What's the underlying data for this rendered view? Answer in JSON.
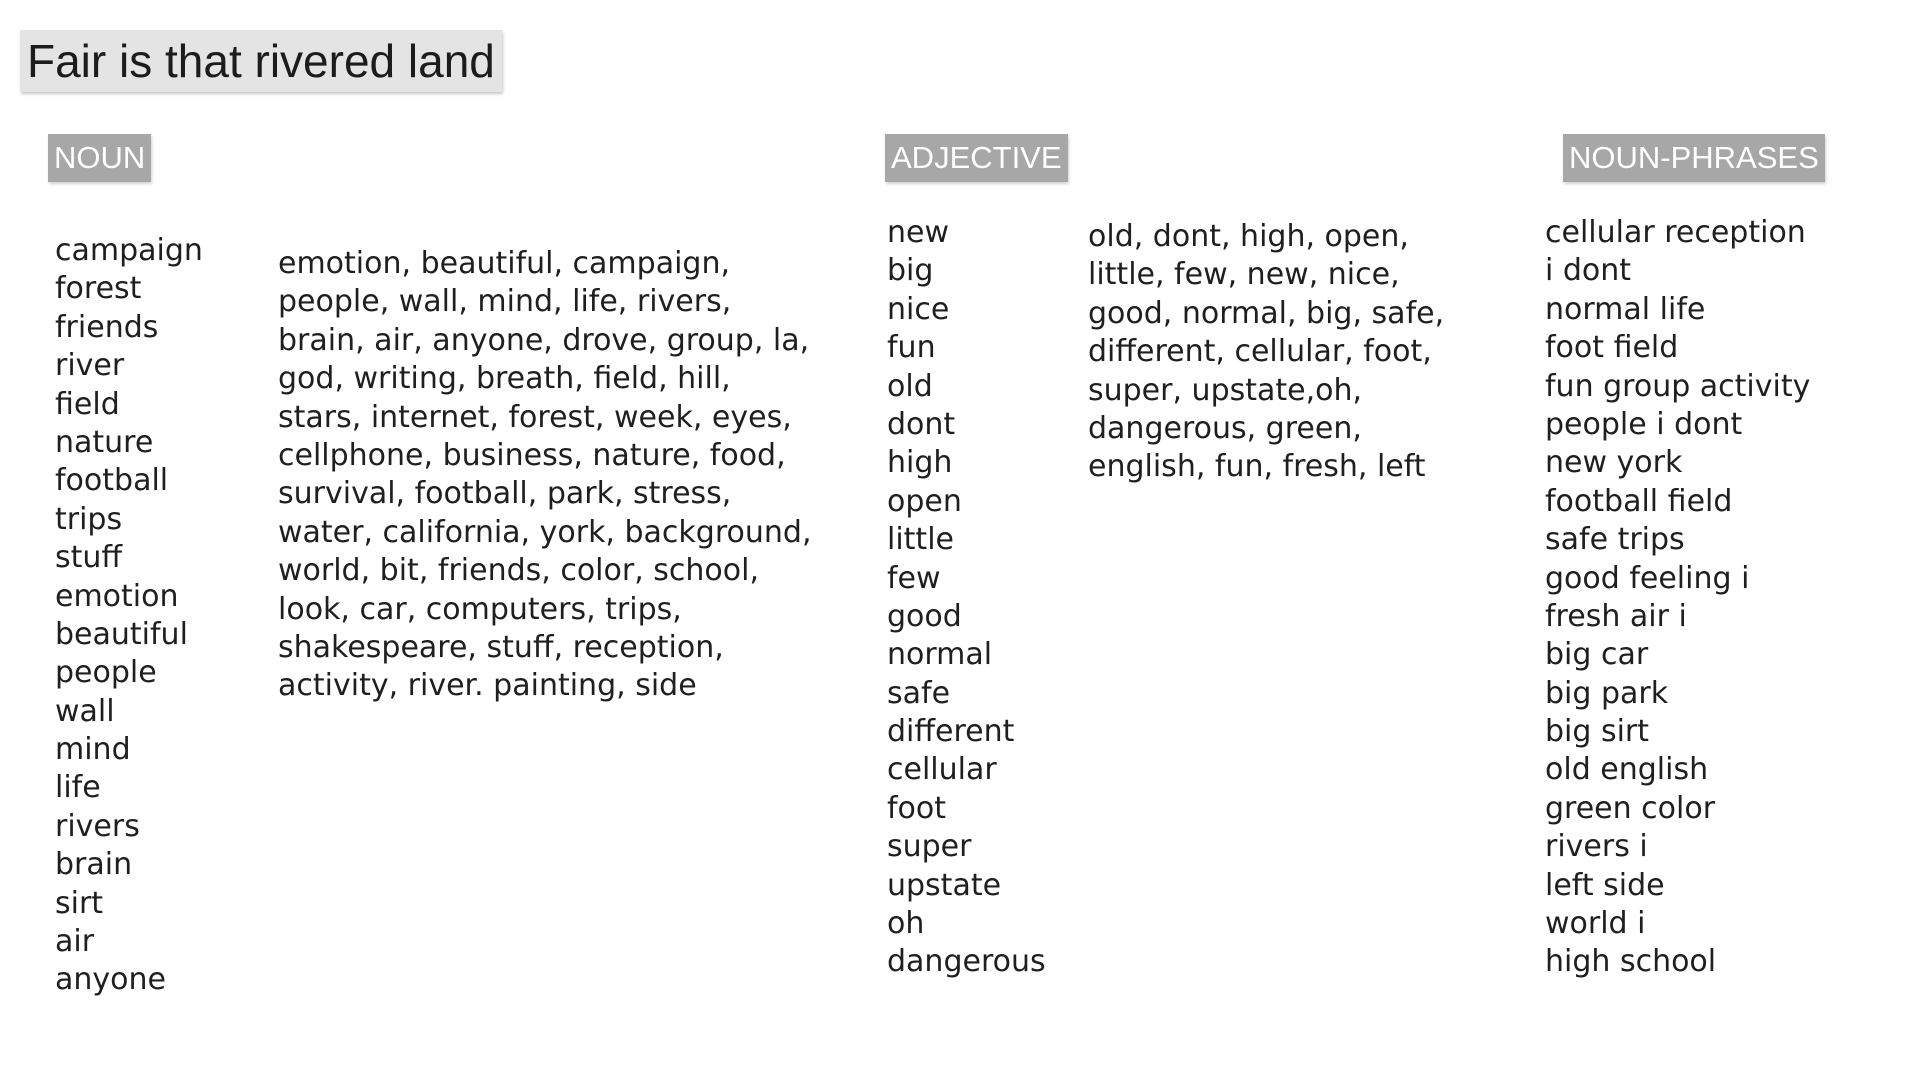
{
  "title": "Fair is that rivered land",
  "sections": {
    "noun": {
      "label": "NOUN",
      "list": [
        "campaign",
        "forest",
        "friends",
        "river",
        "field",
        "nature",
        "football",
        "trips",
        "stuff",
        "emotion",
        "beautiful",
        "people",
        "wall",
        "mind",
        "life",
        "rivers",
        "brain",
        "sirt",
        "air",
        "anyone"
      ],
      "paragraph_lines": [
        "emotion, beautiful, campaign,",
        "people, wall, mind, life, rivers,",
        "brain, air, anyone, drove, group, la,",
        "god, writing, breath, field, hill,",
        "stars, internet, forest, week, eyes,",
        "cellphone, business, nature, food,",
        "survival, football, park, stress,",
        "water, california, york, background,",
        "world, bit, friends, color, school,",
        "look, car, computers, trips,",
        "shakespeare, stuff, reception,",
        "activity, river. painting, side"
      ]
    },
    "adjective": {
      "label": "ADJECTIVE",
      "list": [
        "new",
        "big",
        "nice",
        "fun",
        "old",
        "dont",
        "high",
        "open",
        "little",
        "few",
        "good",
        "normal",
        "safe",
        "different",
        "cellular",
        "foot",
        "super",
        "upstate",
        "oh",
        "dangerous"
      ],
      "paragraph_lines": [
        "old, dont, high, open,",
        "little, few, new, nice,",
        "good, normal, big, safe,",
        "different, cellular, foot,",
        "super, upstate,oh,",
        "dangerous, green,",
        "english, fun, fresh, left"
      ]
    },
    "noun_phrases": {
      "label": "NOUN-PHRASES",
      "list": [
        "cellular reception",
        "i dont",
        "normal life",
        "foot field",
        "fun group activity",
        "people i dont",
        "new york",
        "football field",
        "safe trips",
        "good feeling i",
        "fresh air i",
        "big car",
        "big park",
        "big sirt",
        "old english",
        "green color",
        "rivers i",
        "left side",
        "world i",
        "high school"
      ]
    }
  }
}
